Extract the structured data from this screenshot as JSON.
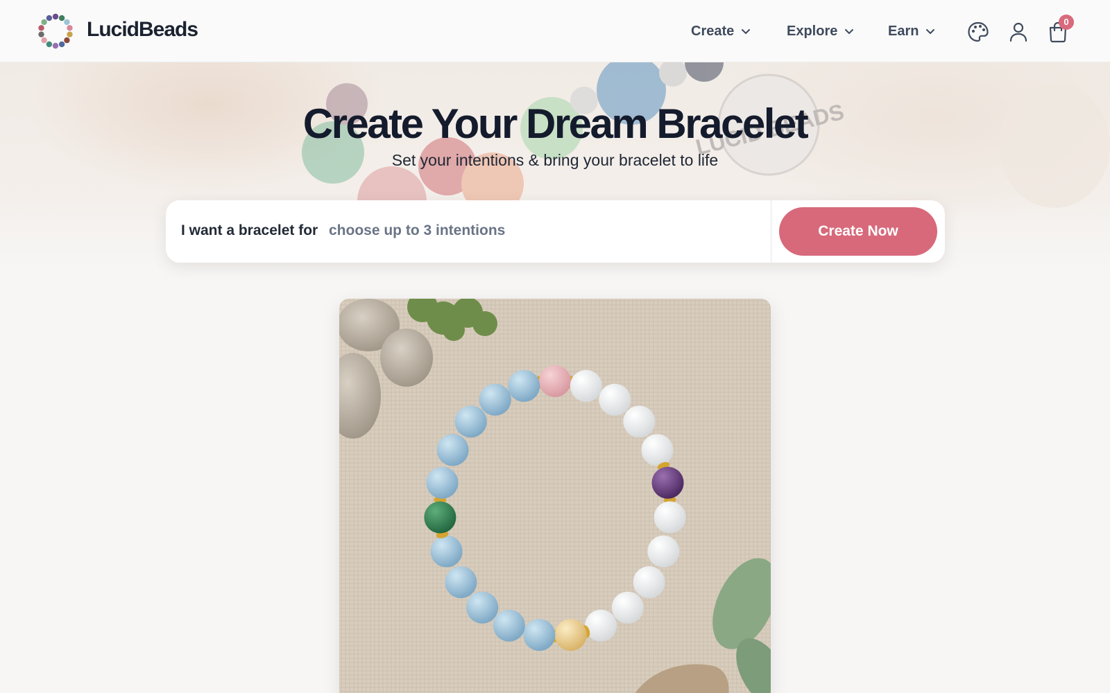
{
  "header": {
    "brand": "LucidBeads",
    "nav": [
      {
        "label": "Create",
        "icon": "chevron-down-icon"
      },
      {
        "label": "Explore",
        "icon": "chevron-down-icon"
      },
      {
        "label": "Earn",
        "icon": "chevron-down-icon"
      }
    ],
    "icons": [
      "palette-icon",
      "user-icon",
      "cart-icon"
    ],
    "cart_count": "0"
  },
  "hero": {
    "title": "Create Your Dream Bracelet",
    "subtitle": "Set your intentions & bring your bracelet to life",
    "charm_text": "LUCID BEADS"
  },
  "intention_form": {
    "label": "I want a bracelet for",
    "placeholder": "choose up to 3 intentions",
    "button": "Create Now"
  },
  "colors": {
    "accent": "#d7697b",
    "heading": "#141b2c",
    "body_text": "#3e4a5c",
    "placeholder": "#6a7486",
    "background": "#f7f6f5"
  }
}
